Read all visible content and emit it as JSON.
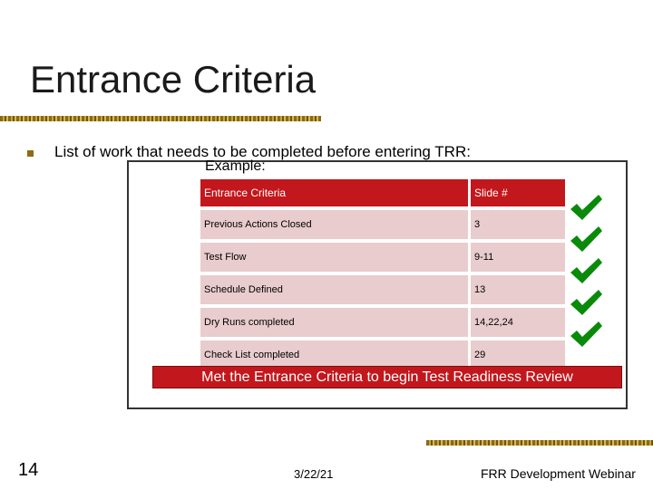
{
  "slide": {
    "title": "Entrance Criteria",
    "bullet": "List of work that needs to be completed before entering TRR:",
    "example_label": "Example:",
    "banner": "Met the Entrance Criteria to begin Test Readiness Review",
    "page_number": "14",
    "date": "3/22/21",
    "footer_title": "FRR Development Webinar"
  },
  "table": {
    "headers": [
      "Entrance Criteria",
      "Slide #"
    ],
    "rows": [
      [
        "Previous Actions Closed",
        "3"
      ],
      [
        "Test Flow",
        "9-11"
      ],
      [
        "Schedule Defined",
        "13"
      ],
      [
        "Dry Runs completed",
        "14,22,24"
      ],
      [
        "Check List completed",
        "29"
      ]
    ]
  },
  "icons": {
    "check": "checkmark-icon",
    "bullet": "square-bullet-icon"
  },
  "colors": {
    "header_red": "#c2171c",
    "row_pink": "#e9cccd",
    "check_green": "#0a8a0a",
    "rule_gold": "#b08a2a"
  }
}
